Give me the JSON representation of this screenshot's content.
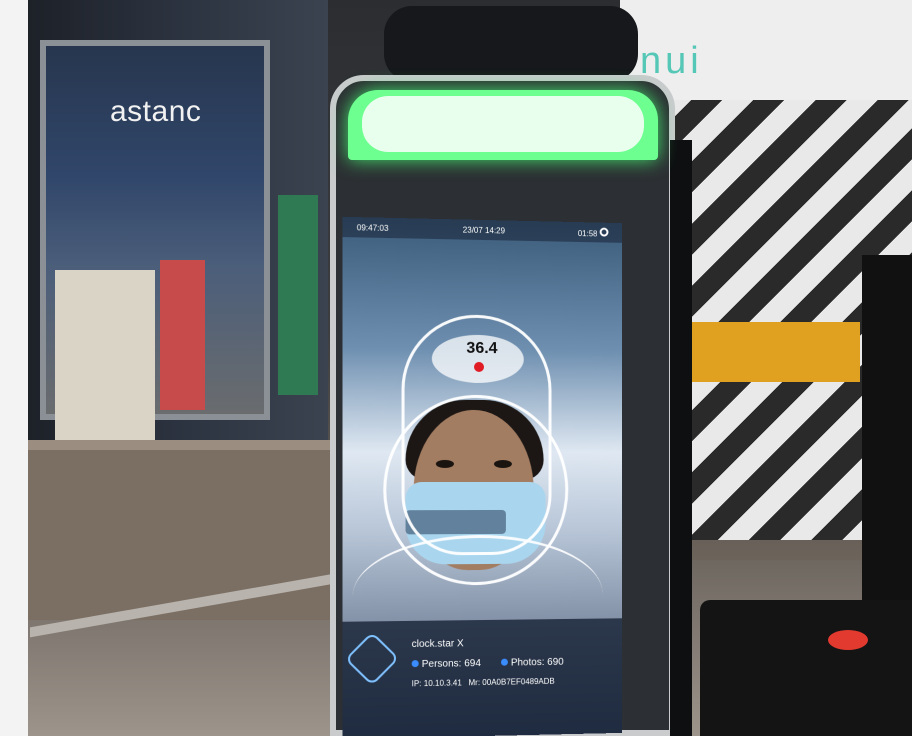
{
  "background": {
    "store_sign": "astanc",
    "ceiling_sign": "nui"
  },
  "kiosk_screen": {
    "status_left": "09:47:03",
    "status_center": "23/07 14:29",
    "status_right": "01:58",
    "temperature": "36.4",
    "device_name": "clock.star X",
    "persons_label": "Persons:",
    "persons_value": "694",
    "photos_label": "Photos:",
    "photos_value": "690",
    "ip_label": "IP:",
    "ip_value": "10.10.3.41",
    "mac_label": "Mr:",
    "mac_value": "00A0B7EF0489ADB"
  },
  "colors": {
    "kiosk_light": "#6dff8f",
    "temperature_dot": "#e01b24",
    "wall_accent": "#e0a020",
    "sign_teal": "#55c7b6"
  }
}
